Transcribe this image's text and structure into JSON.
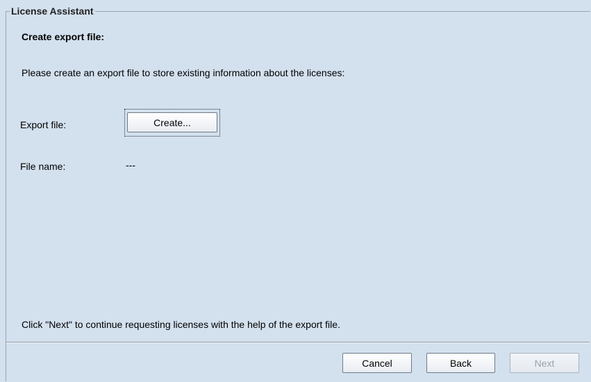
{
  "panel": {
    "title": "License Assistant"
  },
  "content": {
    "heading": "Create export file:",
    "intro": "Please create an export file to store existing information about the licenses:",
    "export_file_label": "Export file:",
    "create_button_label": "Create...",
    "file_name_label": "File name:",
    "file_name_value": "---",
    "footer_note": "Click \"Next\" to continue requesting licenses with the help of the export file."
  },
  "buttons": {
    "cancel_label": "Cancel",
    "back_label": "Back",
    "next_label": "Next",
    "next_enabled": false
  },
  "colors": {
    "background": "#d3e0ee",
    "border": "#9aa3ad",
    "disabled_text": "#9aa2ab"
  }
}
